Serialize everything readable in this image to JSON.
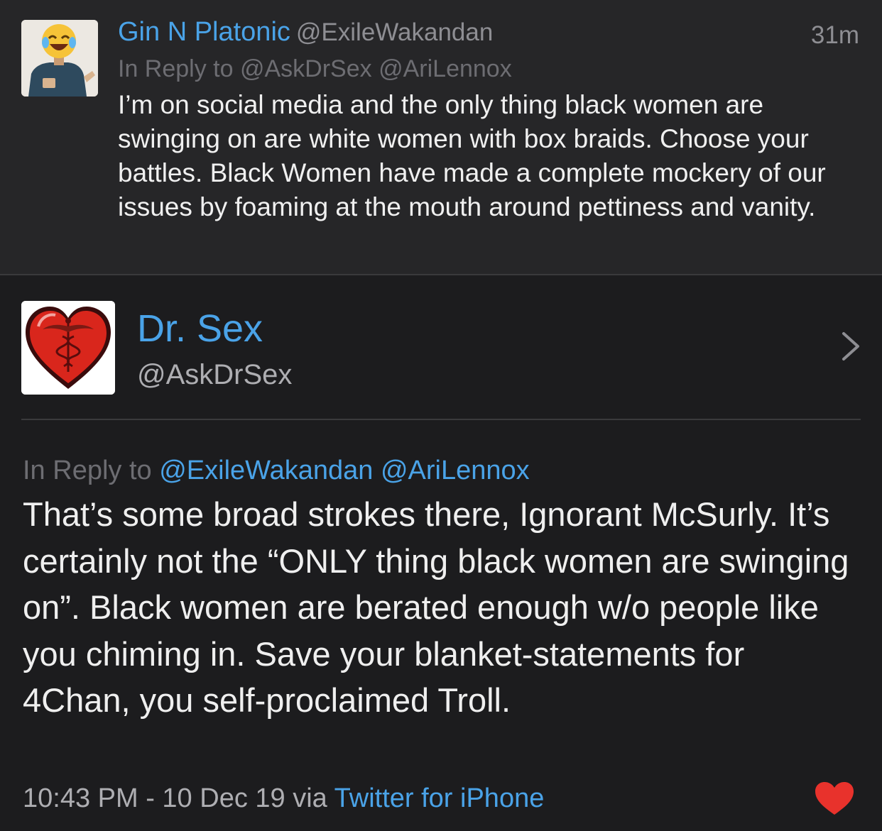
{
  "reply_tweet": {
    "name": "Gin N Platonic",
    "handle": "@ExileWakandan",
    "time": "31m",
    "in_reply_prefix": "In Reply to",
    "in_reply_mentions": "@AskDrSex @AriLennox",
    "body": "I’m on social media and the only thing black women are swinging on are white women with box braids. Choose your battles. Black Women have made a complete mockery of our issues by foaming at the mouth around pettiness and vanity."
  },
  "main_tweet": {
    "name": "Dr. Sex",
    "handle": "@AskDrSex",
    "in_reply_prefix": "In Reply to",
    "in_reply_mentions": "@ExileWakandan @AriLennox",
    "body": "That’s some broad strokes there, Ignorant McSurly. It’s certainly not the “ONLY thing black women are swinging on”. Black women are berated enough w/o people like you chiming in. Save your blanket-statements for 4Chan, you self-proclaimed Troll.",
    "timestamp": "10:43 PM - 10 Dec 19 via",
    "source": "Twitter for iPhone",
    "liked": true
  },
  "icons": {
    "reply_avatar": "laughing-emoji-avatar",
    "main_avatar": "heart-caduceus-avatar",
    "disclosure": "chevron-right-icon",
    "like": "heart-icon"
  },
  "colors": {
    "background": "#1c1c1e",
    "reply_background": "#262628",
    "link": "#4aa3e8",
    "like": "#e8322c"
  }
}
